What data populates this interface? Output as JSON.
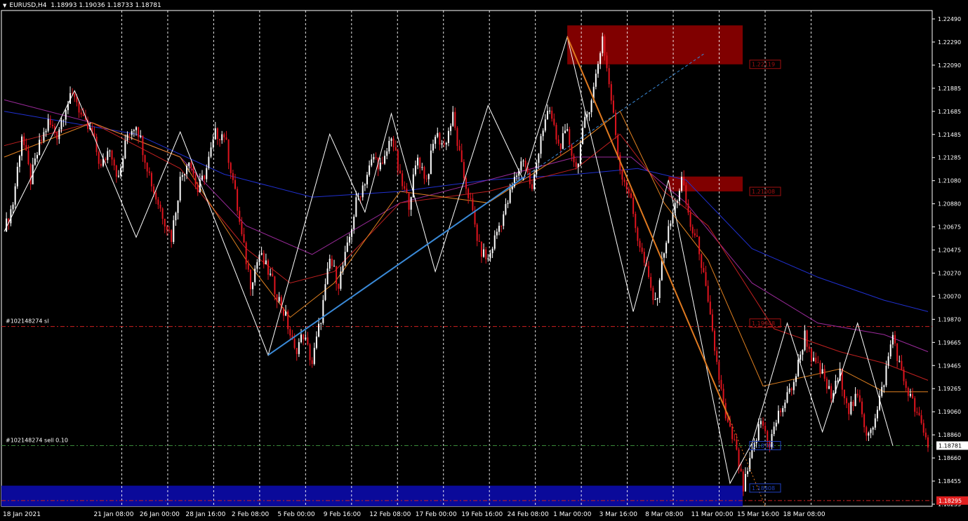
{
  "header": {
    "symbol": "EURUSD,H4",
    "open": "1.18993",
    "high": "1.19036",
    "low": "1.18733",
    "close": "1.18781"
  },
  "colors": {
    "background": "#000000",
    "bull_candle": "#ffffff",
    "bear_candle": "#e0141e",
    "supply_zone": "#800000",
    "demand_zone": "#0a0a9a",
    "grid": "#ffffff",
    "sl_line": "#d02020",
    "entry_line": "#3a8a3a",
    "ma_blue": "#2030d0",
    "ma_purple": "#9a2a9a",
    "ma_red": "#c02020",
    "ma_orange": "#e08020",
    "trend_blue": "#3a8ad8",
    "trend_orange": "#e07a20",
    "zigzag": "#ffffff"
  },
  "chart_data": {
    "type": "candlestick",
    "timeframe": "H4",
    "x_tick_labels": [
      "18 Jan 2021",
      "21 Jan 08:00",
      "26 Jan 00:00",
      "28 Jan 16:00",
      "2 Feb 08:00",
      "5 Feb 00:00",
      "9 Feb 16:00",
      "12 Feb 08:00",
      "17 Feb 00:00",
      "19 Feb 16:00",
      "24 Feb 08:00",
      "1 Mar 00:00",
      "3 Mar 16:00",
      "8 Mar 08:00",
      "11 Mar 00:00",
      "15 Mar 16:00",
      "18 Mar 08:00"
    ],
    "y_ticks": [
      "1.22490",
      "1.22290",
      "1.22090",
      "1.21885",
      "1.21685",
      "1.21485",
      "1.21285",
      "1.21080",
      "1.20880",
      "1.20675",
      "1.20475",
      "1.20270",
      "1.20070",
      "1.19870",
      "1.19665",
      "1.19465",
      "1.19265",
      "1.19060",
      "1.18860",
      "1.18660",
      "1.18455",
      "1.18255"
    ],
    "ylim": [
      1.1825,
      1.2258
    ],
    "price_path": [
      [
        0,
        1.2065
      ],
      [
        4,
        1.209
      ],
      [
        8,
        1.215
      ],
      [
        12,
        1.211
      ],
      [
        16,
        1.214
      ],
      [
        20,
        1.216
      ],
      [
        24,
        1.215
      ],
      [
        28,
        1.2175
      ],
      [
        32,
        1.2185
      ],
      [
        36,
        1.216
      ],
      [
        40,
        1.215
      ],
      [
        44,
        1.212
      ],
      [
        48,
        1.214
      ],
      [
        52,
        1.211
      ],
      [
        56,
        1.215
      ],
      [
        60,
        1.216
      ],
      [
        64,
        1.213
      ],
      [
        68,
        1.21
      ],
      [
        72,
        1.208
      ],
      [
        76,
        1.206
      ],
      [
        80,
        1.211
      ],
      [
        84,
        1.213
      ],
      [
        88,
        1.21
      ],
      [
        92,
        1.212
      ],
      [
        96,
        1.215
      ],
      [
        100,
        1.215
      ],
      [
        104,
        1.211
      ],
      [
        108,
        1.206
      ],
      [
        112,
        1.202
      ],
      [
        116,
        1.2045
      ],
      [
        120,
        1.203
      ],
      [
        124,
        1.201
      ],
      [
        128,
        1.199
      ],
      [
        132,
        1.196
      ],
      [
        136,
        1.1975
      ],
      [
        140,
        1.195
      ],
      [
        144,
        1.199
      ],
      [
        148,
        1.204
      ],
      [
        152,
        1.202
      ],
      [
        156,
        1.205
      ],
      [
        160,
        1.209
      ],
      [
        164,
        1.211
      ],
      [
        168,
        1.213
      ],
      [
        172,
        1.212
      ],
      [
        176,
        1.215
      ],
      [
        180,
        1.211
      ],
      [
        184,
        1.209
      ],
      [
        188,
        1.213
      ],
      [
        192,
        1.211
      ],
      [
        196,
        1.215
      ],
      [
        200,
        1.214
      ],
      [
        204,
        1.2165
      ],
      [
        208,
        1.212
      ],
      [
        212,
        1.209
      ],
      [
        216,
        1.205
      ],
      [
        220,
        1.204
      ],
      [
        224,
        1.2065
      ],
      [
        228,
        1.2085
      ],
      [
        232,
        1.211
      ],
      [
        236,
        1.213
      ],
      [
        240,
        1.21
      ],
      [
        244,
        1.215
      ],
      [
        248,
        1.217
      ],
      [
        252,
        1.214
      ],
      [
        256,
        1.215
      ],
      [
        260,
        1.212
      ],
      [
        264,
        1.216
      ],
      [
        268,
        1.219
      ],
      [
        272,
        1.2235
      ],
      [
        276,
        1.218
      ],
      [
        280,
        1.212
      ],
      [
        284,
        1.21
      ],
      [
        288,
        1.206
      ],
      [
        292,
        1.203
      ],
      [
        296,
        1.2
      ],
      [
        300,
        1.205
      ],
      [
        304,
        1.208
      ],
      [
        308,
        1.211
      ],
      [
        312,
        1.207
      ],
      [
        316,
        1.205
      ],
      [
        320,
        1.2
      ],
      [
        324,
        1.195
      ],
      [
        328,
        1.19
      ],
      [
        332,
        1.188
      ],
      [
        336,
        1.184
      ],
      [
        340,
        1.187
      ],
      [
        344,
        1.19
      ],
      [
        348,
        1.188
      ],
      [
        352,
        1.1905
      ],
      [
        356,
        1.192
      ],
      [
        360,
        1.194
      ],
      [
        364,
        1.1975
      ],
      [
        368,
        1.195
      ],
      [
        372,
        1.194
      ],
      [
        376,
        1.192
      ],
      [
        380,
        1.194
      ],
      [
        384,
        1.191
      ],
      [
        388,
        1.192
      ],
      [
        392,
        1.189
      ],
      [
        396,
        1.19
      ],
      [
        400,
        1.1935
      ],
      [
        404,
        1.1975
      ],
      [
        408,
        1.194
      ],
      [
        412,
        1.192
      ],
      [
        416,
        1.19
      ],
      [
        420,
        1.1878
      ]
    ],
    "ma_series": [
      {
        "key": "ma_blue",
        "values": [
          [
            0,
            1.217
          ],
          [
            60,
            1.215
          ],
          [
            100,
            1.2115
          ],
          [
            140,
            1.2095
          ],
          [
            180,
            1.21
          ],
          [
            220,
            1.211
          ],
          [
            260,
            1.2115
          ],
          [
            288,
            1.212
          ],
          [
            310,
            1.211
          ],
          [
            340,
            1.205
          ],
          [
            370,
            1.2025
          ],
          [
            400,
            1.2005
          ],
          [
            420,
            1.1995
          ]
        ]
      },
      {
        "key": "ma_purple",
        "values": [
          [
            0,
            1.218
          ],
          [
            40,
            1.216
          ],
          [
            80,
            1.213
          ],
          [
            110,
            1.207
          ],
          [
            140,
            1.2045
          ],
          [
            180,
            1.209
          ],
          [
            220,
            1.211
          ],
          [
            260,
            1.213
          ],
          [
            285,
            1.213
          ],
          [
            310,
            1.209
          ],
          [
            340,
            1.202
          ],
          [
            370,
            1.1985
          ],
          [
            400,
            1.1975
          ],
          [
            420,
            1.196
          ]
        ]
      },
      {
        "key": "ma_red",
        "values": [
          [
            0,
            1.214
          ],
          [
            40,
            1.216
          ],
          [
            80,
            1.212
          ],
          [
            110,
            1.205
          ],
          [
            130,
            1.202
          ],
          [
            150,
            1.203
          ],
          [
            180,
            1.209
          ],
          [
            220,
            1.21
          ],
          [
            260,
            1.212
          ],
          [
            280,
            1.215
          ],
          [
            300,
            1.21
          ],
          [
            320,
            1.207
          ],
          [
            350,
            1.198
          ],
          [
            380,
            1.196
          ],
          [
            400,
            1.195
          ],
          [
            420,
            1.1935
          ]
        ]
      },
      {
        "key": "ma_orange",
        "values": [
          [
            0,
            1.213
          ],
          [
            40,
            1.216
          ],
          [
            80,
            1.213
          ],
          [
            110,
            1.204
          ],
          [
            130,
            1.199
          ],
          [
            150,
            1.202
          ],
          [
            180,
            1.21
          ],
          [
            220,
            1.209
          ],
          [
            260,
            1.214
          ],
          [
            280,
            1.217
          ],
          [
            300,
            1.209
          ],
          [
            320,
            1.204
          ],
          [
            345,
            1.193
          ],
          [
            380,
            1.1945
          ],
          [
            400,
            1.1925
          ],
          [
            420,
            1.1925
          ]
        ]
      }
    ],
    "zigzag": [
      [
        0,
        1.2065
      ],
      [
        32,
        1.2188
      ],
      [
        60,
        1.206
      ],
      [
        80,
        1.2152
      ],
      [
        120,
        1.1957
      ],
      [
        148,
        1.215
      ],
      [
        164,
        1.2082
      ],
      [
        176,
        1.2168
      ],
      [
        196,
        1.203
      ],
      [
        220,
        1.2175
      ],
      [
        236,
        1.211
      ],
      [
        256,
        1.2235
      ],
      [
        286,
        1.1995
      ],
      [
        302,
        1.211
      ],
      [
        330,
        1.1845
      ],
      [
        340,
        1.188
      ],
      [
        356,
        1.1985
      ],
      [
        372,
        1.189
      ],
      [
        388,
        1.1985
      ],
      [
        404,
        1.1878
      ]
    ],
    "trendlines": [
      {
        "key": "trend_blue",
        "from": [
          120,
          1.1957
        ],
        "to": [
          236,
          1.2112
        ],
        "style": "solid"
      },
      {
        "key": "trend_blue",
        "from": [
          236,
          1.2112
        ],
        "to": [
          318,
          1.222
        ],
        "style": "dashed"
      },
      {
        "key": "trend_orange",
        "from": [
          256,
          1.2235
        ],
        "to": [
          330,
          1.19
        ],
        "style": "solid"
      },
      {
        "key": "trend_orange",
        "from": [
          330,
          1.19
        ],
        "to": [
          346,
          1.1825
        ],
        "style": "dotted"
      }
    ],
    "zones": [
      {
        "key": "supply_zone",
        "price_from": 1.2211,
        "price_to": 1.2245,
        "label": "1.22119"
      },
      {
        "key": "supply_zone",
        "price_from": 1.21,
        "price_to": 1.2113,
        "label": "1.21008"
      },
      {
        "key": "supply_zone",
        "price_from": 1.1985,
        "price_to": 1.199,
        "label": "1.19848"
      },
      {
        "key": "demand_zone",
        "price_from": 1.1825,
        "price_to": 1.1843,
        "label": "1.18408"
      }
    ],
    "hlines": [
      {
        "price": 1.1982,
        "key": "sl_line",
        "text": "#102148274 sl"
      },
      {
        "price": 1.1878,
        "key": "entry_line",
        "text": "#102148274 sell 0.10",
        "label": "1.18781"
      },
      {
        "price": 1.183,
        "key": "sl_line",
        "label": "1.18295"
      }
    ],
    "current_price": "1.18781",
    "grid": true
  }
}
